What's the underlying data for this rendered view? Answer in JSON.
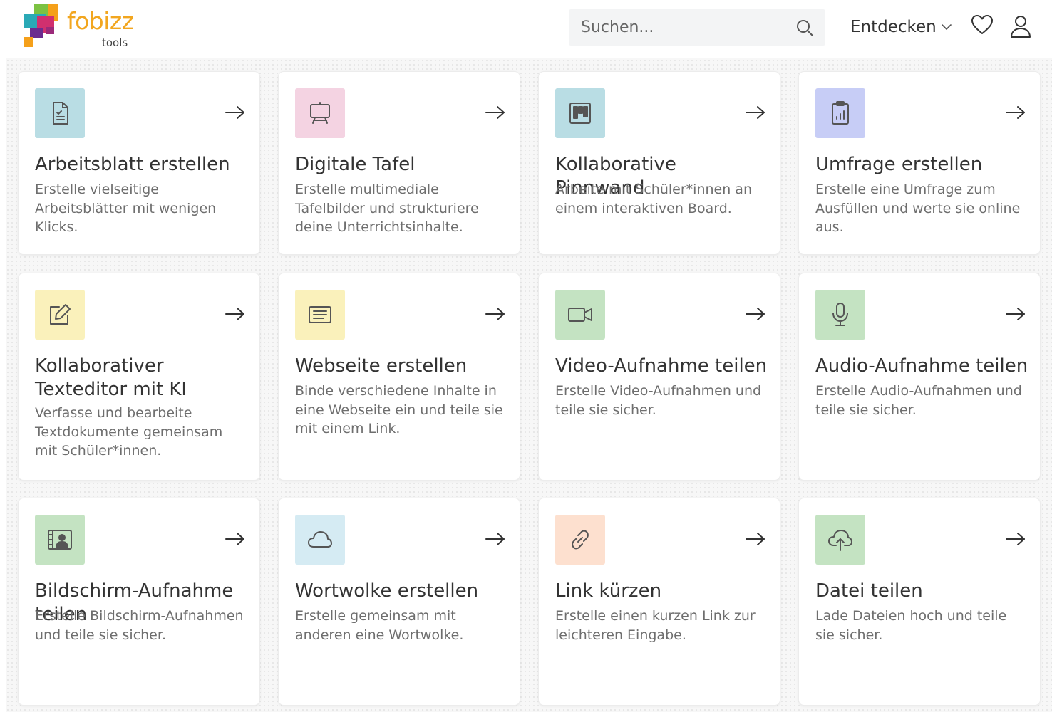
{
  "header": {
    "logo_text": "fobizz",
    "logo_sub": "tools",
    "search_placeholder": "Suchen...",
    "nav_discover": "Entdecken"
  },
  "tools": [
    {
      "title": "Arbeitsblatt erstellen",
      "description": "Erstelle vielseitige Arbeitsblätter mit wenigen Klicks.",
      "icon": "worksheet-icon",
      "tile_color": "#b9dde4"
    },
    {
      "title": "Digitale Tafel",
      "description": "Erstelle multimediale Tafelbilder und strukturiere deine Unterrichtsinhalte.",
      "icon": "whiteboard-icon",
      "tile_color": "#f4d3e2"
    },
    {
      "title": "Kollaborative Pinnwand",
      "description": "Arbeite mit Schüler*innen an einem interaktiven Board.",
      "icon": "board-icon",
      "tile_color": "#b9dde4"
    },
    {
      "title": "Umfrage erstellen",
      "description": "Erstelle eine Umfrage zum Ausfüllen und werte sie online aus.",
      "icon": "survey-icon",
      "tile_color": "#c7cdf6"
    },
    {
      "title": "Kollaborativer Texteditor mit KI",
      "description": "Verfasse und bearbeite Textdokumente gemeinsam mit Schüler*innen.",
      "icon": "edit-icon",
      "tile_color": "#faf1bb"
    },
    {
      "title": "Webseite erstellen",
      "description": "Binde verschiedene Inhalte in eine Webseite ein und teile sie mit einem Link.",
      "icon": "webpage-icon",
      "tile_color": "#faf1bb"
    },
    {
      "title": "Video-Aufnahme teilen",
      "description": "Erstelle Video-Aufnahmen und teile sie sicher.",
      "icon": "video-camera-icon",
      "tile_color": "#c4e3c2"
    },
    {
      "title": "Audio-Aufnahme teilen",
      "description": "Erstelle Audio-Aufnahmen und teile sie sicher.",
      "icon": "microphone-icon",
      "tile_color": "#c4e3c2"
    },
    {
      "title": "Bildschirm-Aufnahme teilen",
      "description": "Erstelle Bildschirm-Aufnahmen und teile sie sicher.",
      "icon": "screen-recording-icon",
      "tile_color": "#c4e3c2"
    },
    {
      "title": "Wortwolke erstellen",
      "description": "Erstelle gemeinsam mit anderen eine Wortwolke.",
      "icon": "cloud-icon",
      "tile_color": "#d5ebf3"
    },
    {
      "title": "Link kürzen",
      "description": "Erstelle einen kurzen Link zur leichteren Eingabe.",
      "icon": "link-icon",
      "tile_color": "#fde0cf"
    },
    {
      "title": "Datei teilen",
      "description": "Lade Dateien hoch und teile sie sicher.",
      "icon": "upload-cloud-icon",
      "tile_color": "#c4e3c2"
    }
  ]
}
